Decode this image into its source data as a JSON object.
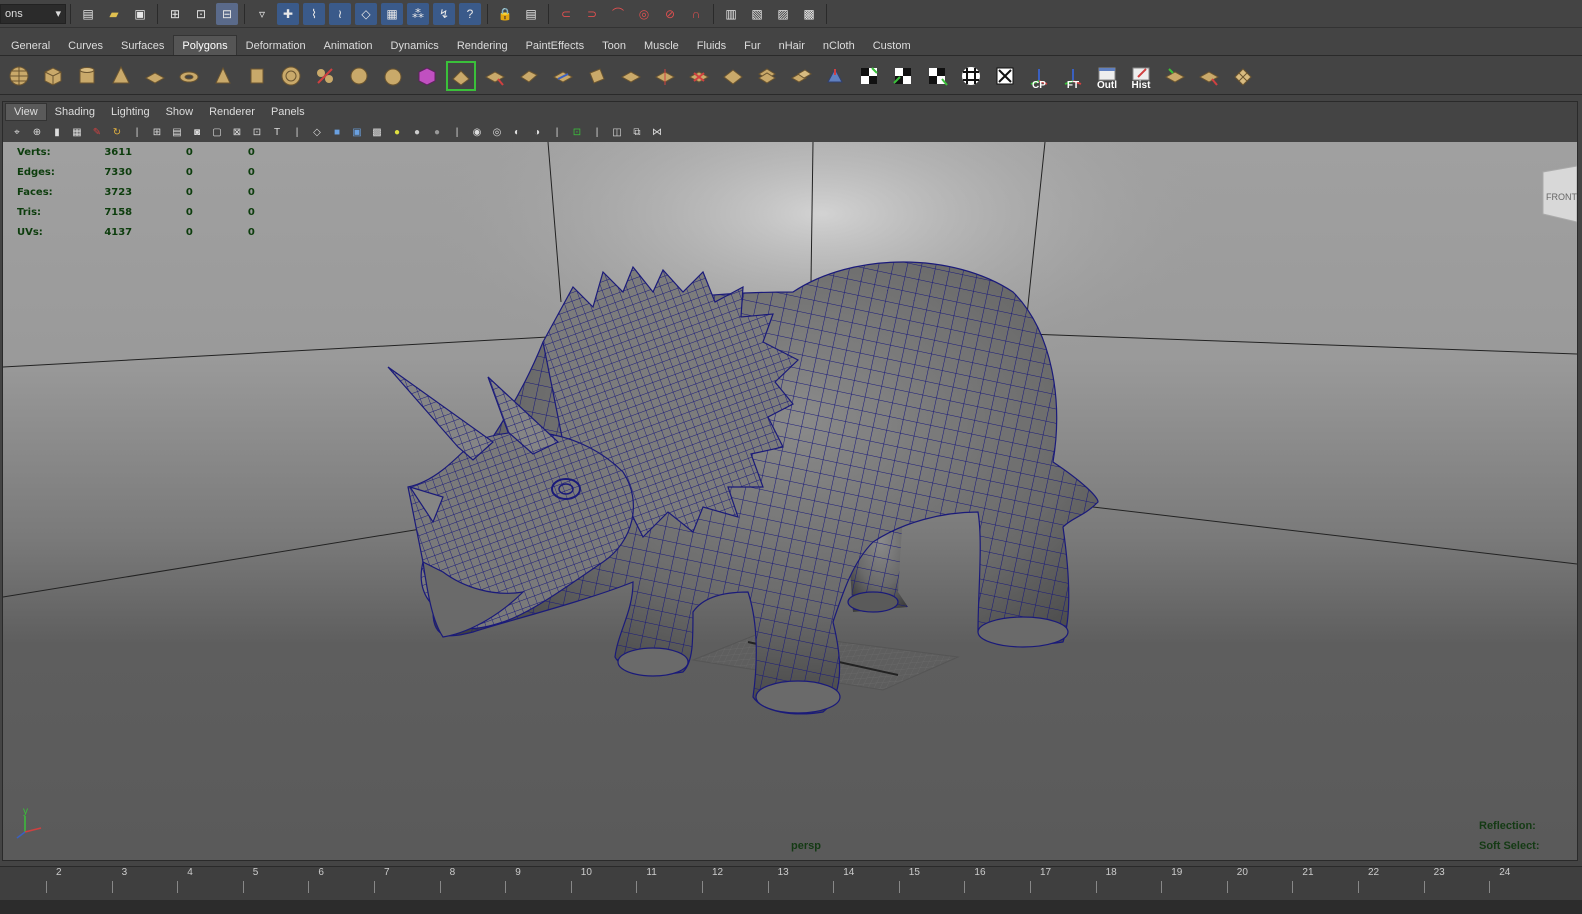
{
  "topbar": {
    "menu_set_value": "ons",
    "icons": [
      "new-scene-icon",
      "open-scene-icon",
      "save-scene-icon",
      "select-hierarchy-icon",
      "select-object-icon",
      "select-component-icon",
      "lasso-icon",
      "snap-grid-icon",
      "snap-curve-icon",
      "snap-point-icon",
      "snap-view-plane-icon",
      "make-live-icon",
      "history-icon",
      "render-current-icon",
      "ipr-render-icon",
      "render-settings-icon",
      "hypershade-icon"
    ]
  },
  "shelf_tabs": [
    "General",
    "Curves",
    "Surfaces",
    "Polygons",
    "Deformation",
    "Animation",
    "Dynamics",
    "Rendering",
    "PaintEffects",
    "Toon",
    "Muscle",
    "Fluids",
    "Fur",
    "nHair",
    "nCloth",
    "Custom"
  ],
  "shelf_active_tab": "Polygons",
  "shelf_labels": {
    "cp": "CP",
    "ft": "FT",
    "outl": "Outl",
    "hist": "Hist"
  },
  "panel_menu": [
    "View",
    "Shading",
    "Lighting",
    "Show",
    "Renderer",
    "Panels"
  ],
  "hud": {
    "rows": [
      {
        "label": "Verts:",
        "a": "3611",
        "b": "0",
        "c": "0"
      },
      {
        "label": "Edges:",
        "a": "7330",
        "b": "0",
        "c": "0"
      },
      {
        "label": "Faces:",
        "a": "3723",
        "b": "0",
        "c": "0"
      },
      {
        "label": "Tris:",
        "a": "7158",
        "b": "0",
        "c": "0"
      },
      {
        "label": "UVs:",
        "a": "4137",
        "b": "0",
        "c": "0"
      }
    ],
    "camera": "persp",
    "reflection": "Reflection:",
    "soft_select": "Soft Select:",
    "view_cube_label": "FRONT",
    "axis_y": "y"
  },
  "timeslider": {
    "frames": [
      "2",
      "3",
      "4",
      "5",
      "6",
      "7",
      "8",
      "9",
      "10",
      "11",
      "12",
      "13",
      "14",
      "15",
      "16",
      "17",
      "18",
      "19",
      "20",
      "21",
      "22",
      "23",
      "24"
    ]
  },
  "colors": {
    "wireframe": "#1a1a7a",
    "hud_text": "#0d3d0d",
    "ui_bg": "#444444"
  }
}
